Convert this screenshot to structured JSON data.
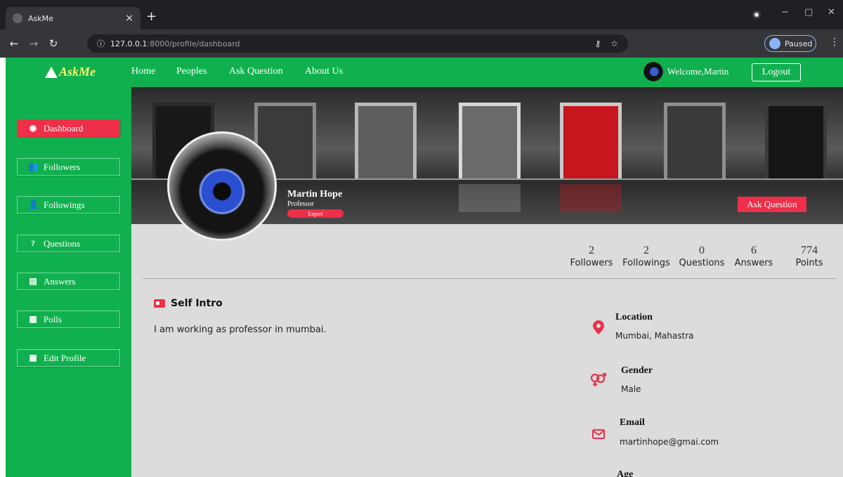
{
  "browser": {
    "tab_title": "AskMe",
    "tab_close": "×",
    "new_tab": "+",
    "url_host": "127.0.0.1",
    "url_path": ":8000/profile/dashboard",
    "profile_label": "Paused",
    "win_min": "−",
    "win_max": "▢",
    "win_close": "✕"
  },
  "nav": {
    "logo": "AskMe",
    "links": [
      "Home",
      "Peoples",
      "Ask Question",
      "About Us"
    ],
    "welcome": "Welcome,Martin",
    "logout": "Logout"
  },
  "sidebar": {
    "items": [
      {
        "label": "Dashboard",
        "icon": "dashboard-icon",
        "glyph": "◉"
      },
      {
        "label": "Followers",
        "icon": "users-icon",
        "glyph": "👥"
      },
      {
        "label": "Followings",
        "icon": "user-check-icon",
        "glyph": "👤"
      },
      {
        "label": "Questions",
        "icon": "question-icon",
        "glyph": "?"
      },
      {
        "label": "Answers",
        "icon": "file-icon",
        "glyph": "▤"
      },
      {
        "label": "Polls",
        "icon": "poll-icon",
        "glyph": "▦"
      },
      {
        "label": "Edit Profile",
        "icon": "edit-icon",
        "glyph": "▦"
      }
    ]
  },
  "profile": {
    "name": "Martin Hope",
    "role": "Professor",
    "badge": "Expert",
    "ask_button": "Ask Question"
  },
  "stats": [
    {
      "value": "2",
      "label": "Followers"
    },
    {
      "value": "2",
      "label": "Followings"
    },
    {
      "value": "0",
      "label": "Questions"
    },
    {
      "value": "6",
      "label": "Answers"
    },
    {
      "value": "774",
      "label": "Points"
    }
  ],
  "intro": {
    "title": "Self Intro",
    "text": "I am working as professor in mumbai."
  },
  "info": {
    "location_title": "Location",
    "location_value": "Mumbai, Mahastra",
    "gender_title": "Gender",
    "gender_value": "Male",
    "email_title": "Email",
    "email_value": "martinhope@gmai.com",
    "age_title": "Age"
  },
  "colors": {
    "brand_green": "#10b04e",
    "accent_red": "#ed2f49",
    "page_bg": "#dcdcdc"
  }
}
